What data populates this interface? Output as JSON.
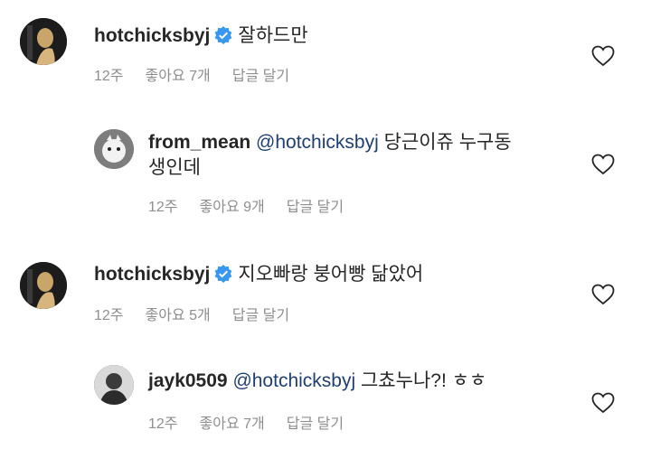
{
  "comments": [
    {
      "username": "hotchicksbyj",
      "verified": true,
      "mention": "",
      "text": "잘하드만",
      "text_line2": "",
      "time": "12주",
      "likes": "좋아요 7개",
      "reply_label": "답글 달기"
    },
    {
      "username": "from_mean",
      "verified": false,
      "mention": "@hotchicksbyj",
      "text": "당근이쥬  누구동",
      "text_line2": "생인데",
      "time": "12주",
      "likes": "좋아요 9개",
      "reply_label": "답글 달기"
    },
    {
      "username": "hotchicksbyj",
      "verified": true,
      "mention": "",
      "text": "지오빠랑 붕어빵 닮았어",
      "text_line2": "",
      "time": "12주",
      "likes": "좋아요 5개",
      "reply_label": "답글 달기"
    },
    {
      "username": "jayk0509",
      "verified": false,
      "mention": "@hotchicksbyj",
      "text": "그쵸누나?! ㅎㅎ",
      "text_line2": "",
      "time": "12주",
      "likes": "좋아요 7개",
      "reply_label": "답글 달기"
    }
  ],
  "colors": {
    "verified": "#3897f0",
    "mention": "#1f3f74",
    "meta": "#8e8e8e"
  },
  "icons": [
    "verified-badge-icon",
    "heart-icon"
  ]
}
